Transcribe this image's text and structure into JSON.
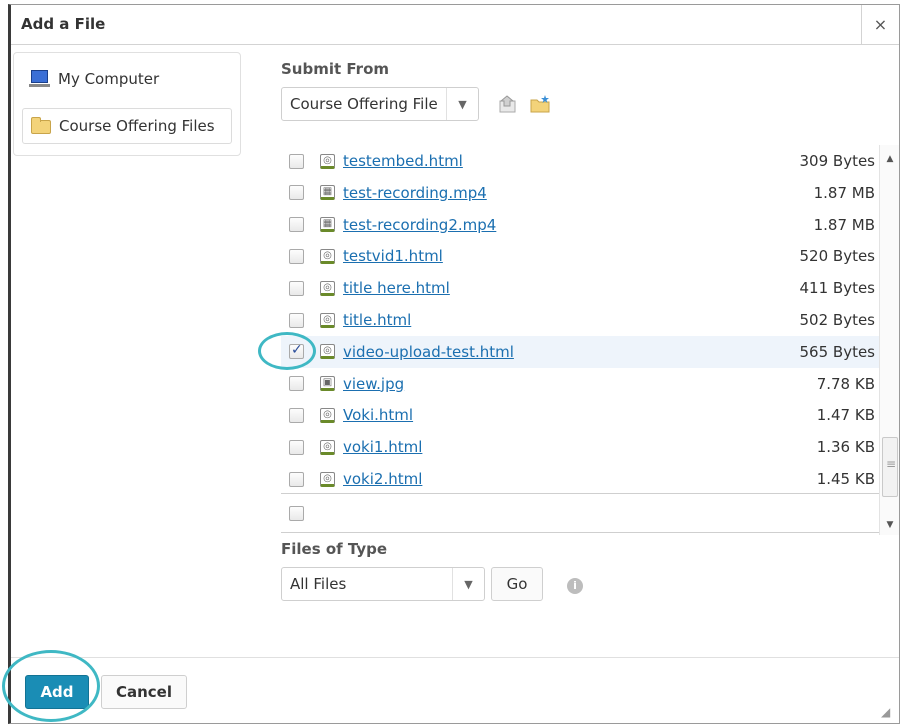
{
  "dialog": {
    "title": "Add a File",
    "close_glyph": "×"
  },
  "sidebar": {
    "items": [
      {
        "label": "My Computer",
        "icon": "computer-icon",
        "selected": false
      },
      {
        "label": "Course Offering Files",
        "icon": "folder-icon",
        "selected": true
      }
    ]
  },
  "submit_from": {
    "label": "Submit From",
    "selected": "Course Offering File"
  },
  "files": [
    {
      "name": "testembed.html",
      "size": "309 Bytes",
      "icon": "web-file-icon",
      "checked": false
    },
    {
      "name": "test-recording.mp4",
      "size": "1.87 MB",
      "icon": "video-file-icon",
      "checked": false
    },
    {
      "name": "test-recording2.mp4",
      "size": "1.87 MB",
      "icon": "video-file-icon",
      "checked": false
    },
    {
      "name": "testvid1.html",
      "size": "520 Bytes",
      "icon": "web-file-icon",
      "checked": false
    },
    {
      "name": "title here.html",
      "size": "411 Bytes",
      "icon": "web-file-icon",
      "checked": false
    },
    {
      "name": "title.html",
      "size": "502 Bytes",
      "icon": "web-file-icon",
      "checked": false
    },
    {
      "name": "video-upload-test.html",
      "size": "565 Bytes",
      "icon": "web-file-icon",
      "checked": true
    },
    {
      "name": "view.jpg",
      "size": "7.78 KB",
      "icon": "image-file-icon",
      "checked": false
    },
    {
      "name": "Voki.html",
      "size": "1.47 KB",
      "icon": "web-file-icon",
      "checked": false
    },
    {
      "name": "voki1.html",
      "size": "1.36 KB",
      "icon": "web-file-icon",
      "checked": false
    },
    {
      "name": "voki2.html",
      "size": "1.45 KB",
      "icon": "web-file-icon",
      "checked": false
    }
  ],
  "files_of_type": {
    "label": "Files of Type",
    "selected": "All Files",
    "go_label": "Go",
    "info_glyph": "i"
  },
  "footer": {
    "add_label": "Add",
    "cancel_label": "Cancel"
  },
  "colors": {
    "primary": "#1a8db5",
    "link": "#1b6fb0",
    "highlight_ring": "#3fb8c4",
    "selected_row": "#eef4fb"
  }
}
